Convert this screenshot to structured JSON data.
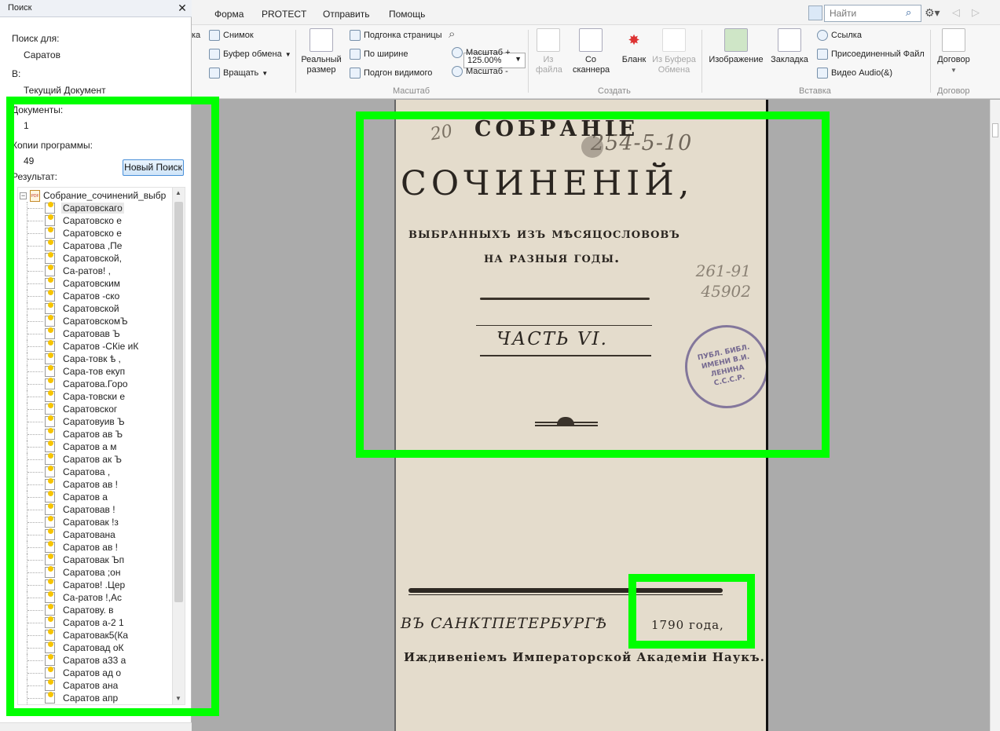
{
  "menu": {
    "items": [
      "Форма",
      "PROTECT",
      "Отправить",
      "Помощь"
    ],
    "search_placeholder": "Найти"
  },
  "ribbon": {
    "tools": {
      "partial_label": "ка",
      "snapshot": "Снимок",
      "clipboard": "Буфер обмена",
      "rotate": "Вращать"
    },
    "scale": {
      "actual_size": "Реальный размер",
      "fit_page": "Подгонка страницы",
      "fit_width": "По ширине",
      "fit_visible": "Подгон видимого",
      "zoom_value": "125.00%",
      "zoom_in": "Масштаб +",
      "zoom_out": "Масштаб -",
      "group": "Масштаб"
    },
    "create": {
      "from_file": "Из файла",
      "from_scanner": "Со сканнера",
      "blank": "Бланк",
      "from_clipboard": "Из Буфера Обмена",
      "group": "Создать"
    },
    "insert": {
      "image": "Изображение",
      "bookmark": "Закладка",
      "link": "Ссылка",
      "attached_file": "Присоединенный Файл",
      "video_audio": "Видео Audio(&)",
      "group": "Вставка"
    },
    "contract": {
      "button": "Договор",
      "group": "Договор"
    }
  },
  "search_panel": {
    "title": "Поиск",
    "search_for_label": "Поиск для:",
    "search_for_value": "Саратов",
    "in_label": "В:",
    "in_value": "Текущий Документ",
    "documents_label": "Документы:",
    "documents_value": "1",
    "copies_label": "Копии программы:",
    "copies_value": "49",
    "new_search": "Новый Поиск",
    "result_label": "Результат:",
    "root_name": "Собрание_сочинений_выбр",
    "results": [
      "Саратовскаго",
      "Саратовско е",
      "Саратовско е",
      "Саратова ,Пе",
      "Саратовской,",
      "Са-ратов! ,",
      "Саратовским",
      "Саратов -ско",
      "Саратовской",
      "СаратовскомЪ",
      "Саратовав Ъ",
      "Саратов -СКіе иК",
      "Сара-товк ѣ ,",
      "Сара-тов екуп",
      "Саратова.Горо",
      "Сара-товски е",
      "Саратовског",
      "Саратовуив Ъ",
      "Саратов ав Ъ",
      "Саратов а м",
      "Саратов ак Ъ",
      "Саратова ,",
      "Саратов ав !",
      "Саратов а",
      "Саратовав !",
      "Саратовак !з",
      "Саратована",
      "Саратов ав !",
      "Саратовак Ъп",
      "Саратова ;он",
      "Саратов! .Цер",
      "Са-ратов !,Ас",
      "Саратову. в",
      "Саратов а-2 1",
      "Саратовак5(Ка",
      "Саратовад оК",
      "Саратов а33 а",
      "Саратов ад о",
      "Саратов ана",
      "Саратов апр"
    ]
  },
  "document": {
    "title_line1": "СОБРАНІЕ",
    "title_line2": "СОЧИНЕНІЙ,",
    "subtitle_line1": "выбранныхъ изъ мѣсяцослововъ",
    "subtitle_line2": "на разныя годы.",
    "part": "ЧАСТЬ VI.",
    "handwritten_top": "254-5-10",
    "handwritten_left": "20",
    "handwritten_right": "261-91 45902",
    "stamp_text": "ПУБЛ. БИБЛ. ИМЕНИ В.И. ЛЕНИНА С.С.С.Р.",
    "city": "ВЪ САНКТПЕТЕРБУРГѢ",
    "year": "1790 года,",
    "publisher": "Иждивенiемъ Императорской Академiи Наукъ."
  }
}
